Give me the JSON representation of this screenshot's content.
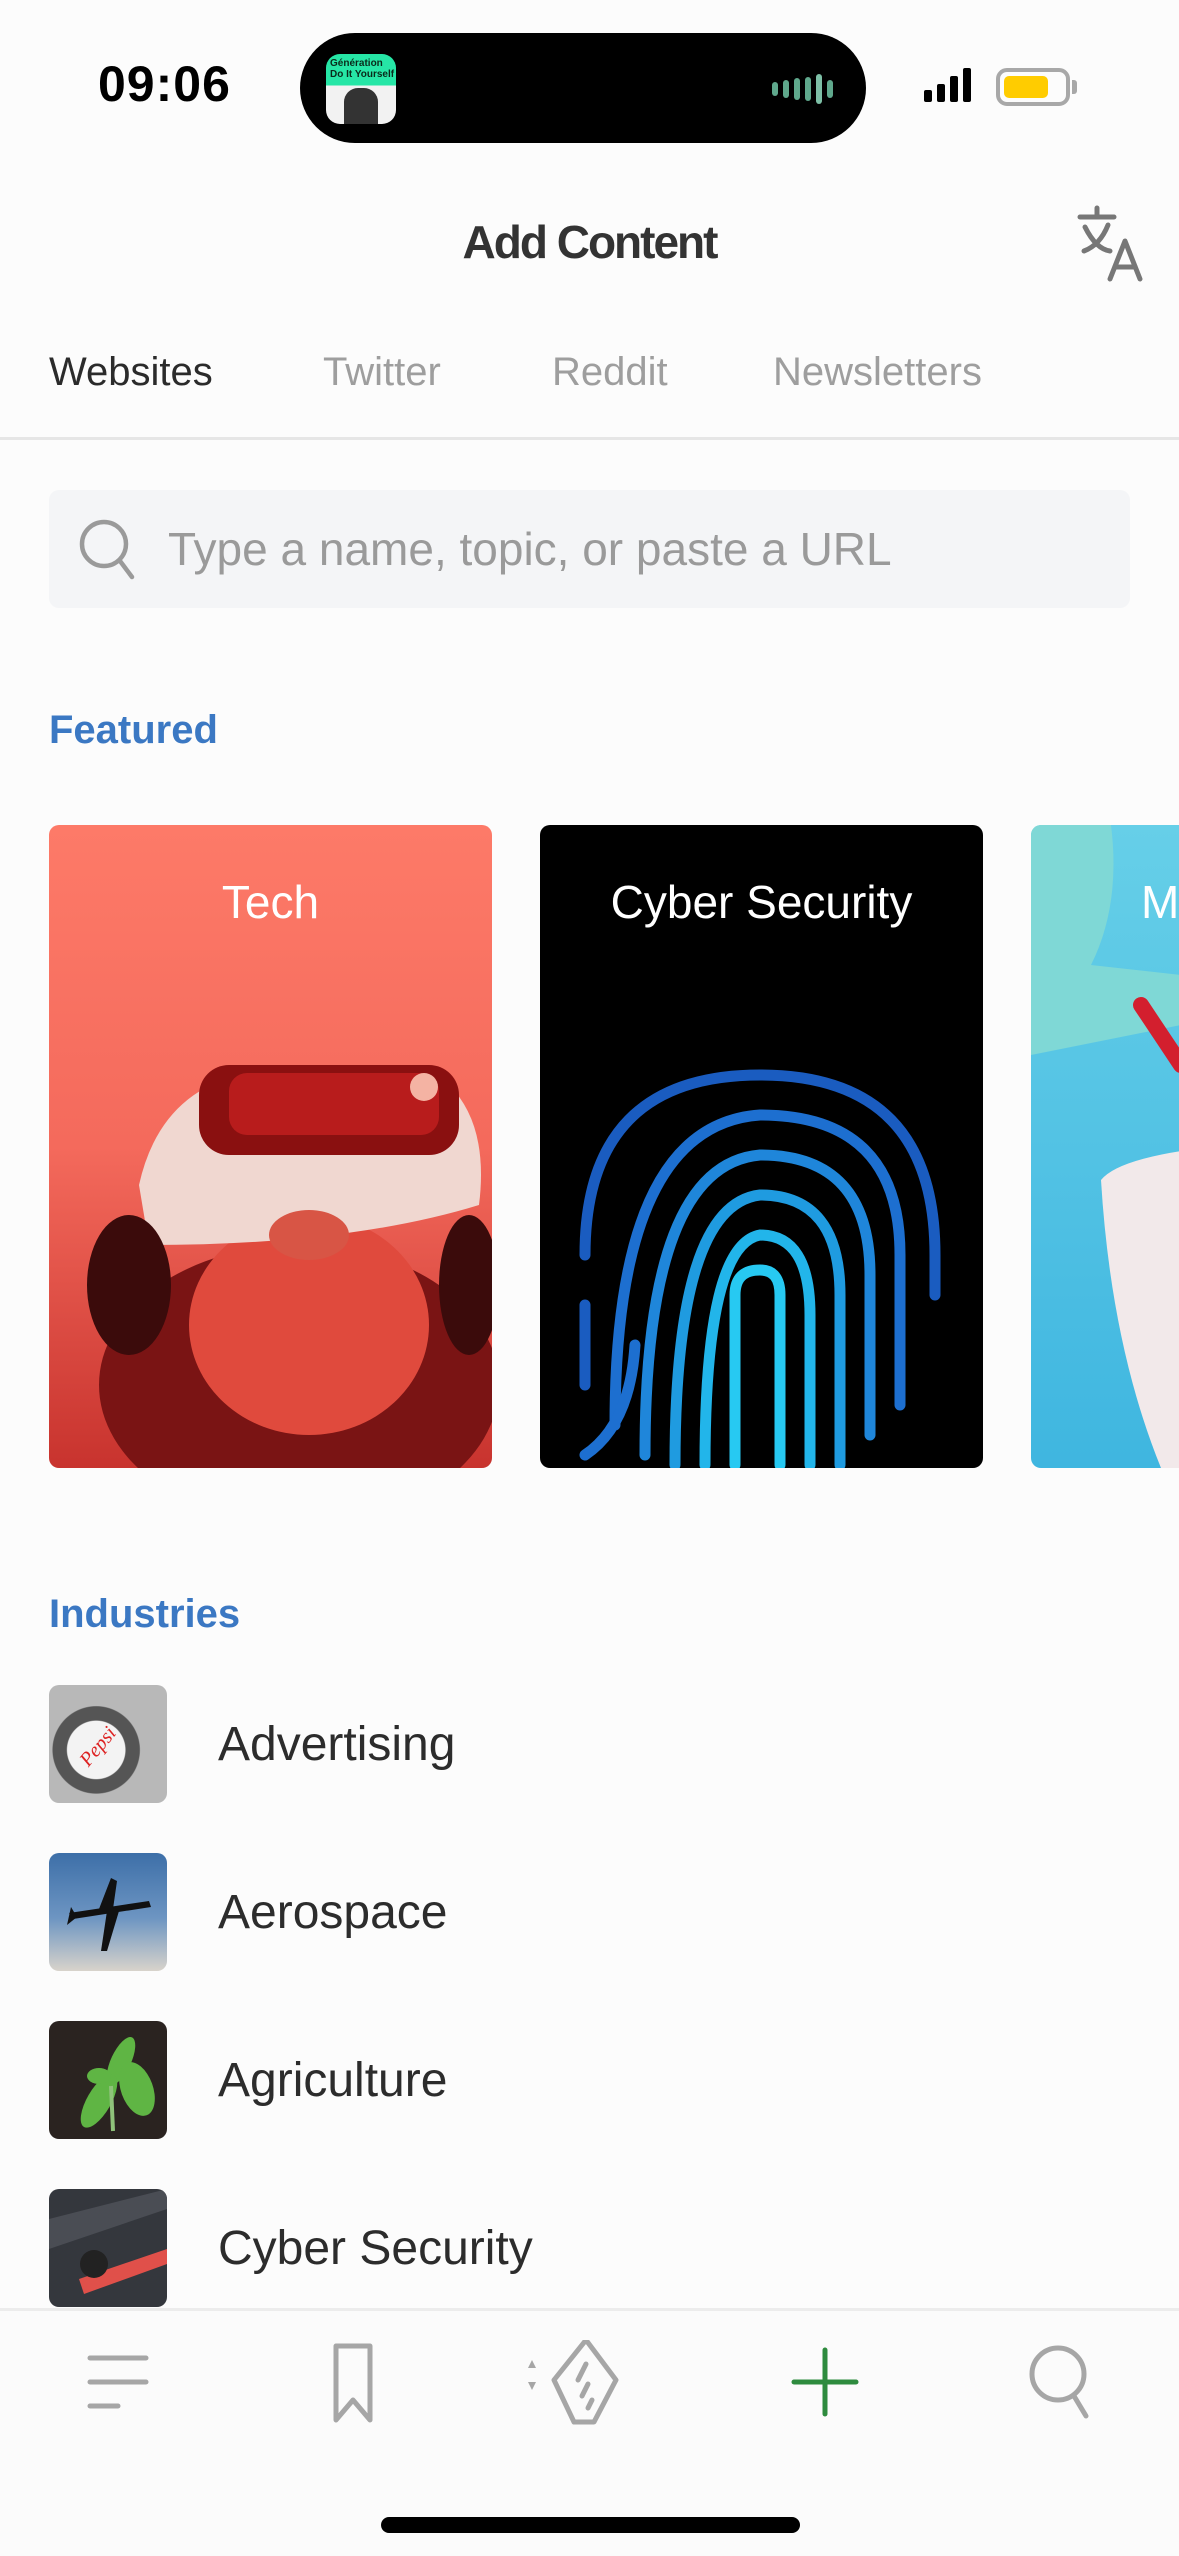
{
  "status_bar": {
    "time": "09:06",
    "now_playing_art_text": "Génération Do It Yourself",
    "battery_level": 0.6,
    "signal_bars": 4
  },
  "header": {
    "title": "Add Content",
    "translate_icon": "translate-icon"
  },
  "tabs": [
    {
      "label": "Websites",
      "active": true
    },
    {
      "label": "Twitter",
      "active": false
    },
    {
      "label": "Reddit",
      "active": false
    },
    {
      "label": "Newsletters",
      "active": false
    }
  ],
  "search": {
    "placeholder": "Type a name, topic, or paste a URL",
    "value": "",
    "icon": "search-icon"
  },
  "featured": {
    "label": "Featured",
    "cards": [
      {
        "title": "Tech"
      },
      {
        "title": "Cyber Security"
      },
      {
        "title": "M"
      }
    ]
  },
  "industries": {
    "label": "Industries",
    "items": [
      {
        "label": "Advertising"
      },
      {
        "label": "Aerospace"
      },
      {
        "label": "Agriculture"
      },
      {
        "label": "Cyber Security"
      }
    ]
  },
  "tab_bar": {
    "items": [
      {
        "icon": "menu-icon",
        "active": false
      },
      {
        "icon": "bookmark-icon",
        "active": false
      },
      {
        "icon": "feedly-icon",
        "active": false
      },
      {
        "icon": "plus-icon",
        "active": true
      },
      {
        "icon": "search-icon",
        "active": false
      }
    ],
    "active_color": "#2e8b3e",
    "inactive_color": "#a6a6a6"
  },
  "colors": {
    "section_label": "#3b78c3",
    "active_tab": "#2b2b2b",
    "inactive_tab": "#9e9e9e"
  }
}
